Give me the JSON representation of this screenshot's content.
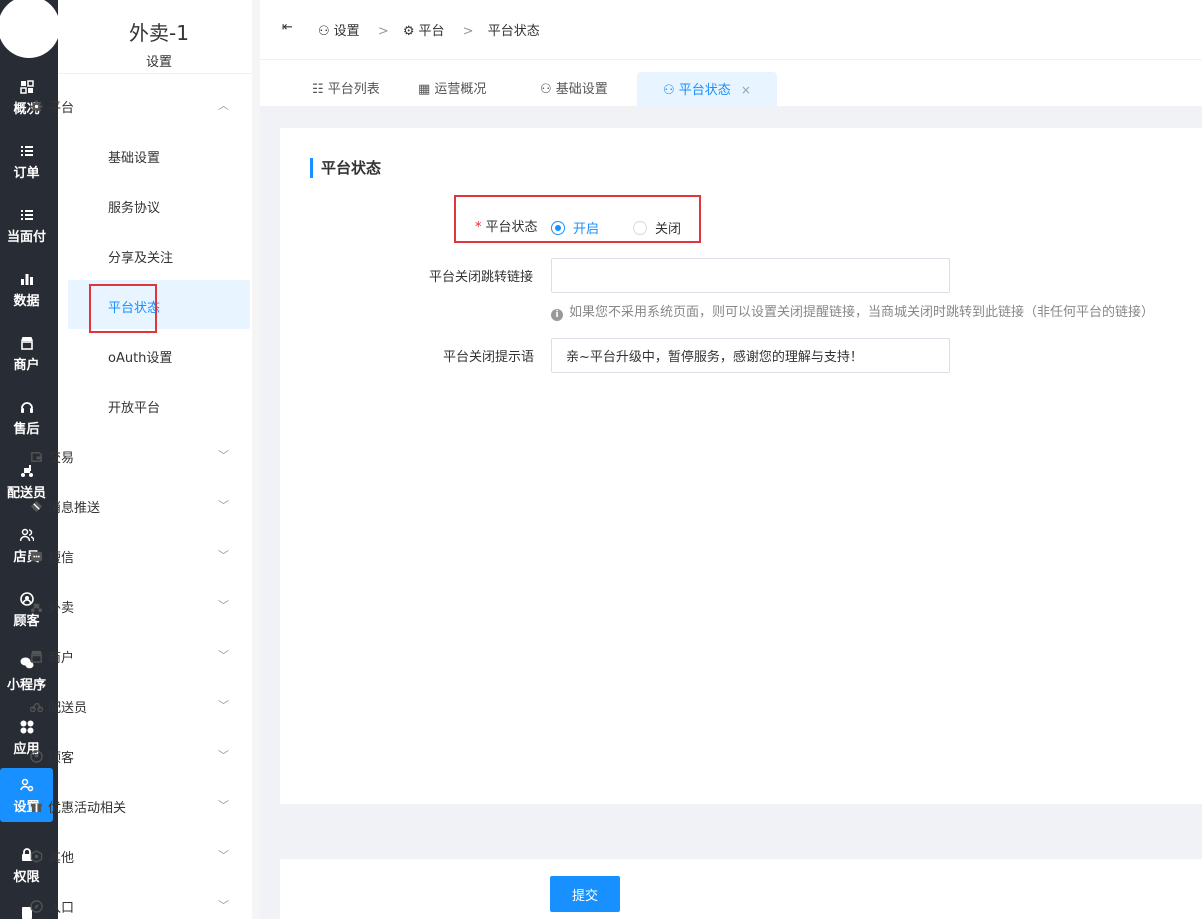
{
  "app": {
    "title": "外卖-1",
    "subtitle": "设置"
  },
  "rail": [
    {
      "label": "概况",
      "icon": "dashboard-icon"
    },
    {
      "label": "订单",
      "icon": "list-icon"
    },
    {
      "label": "当面付",
      "icon": "list-icon"
    },
    {
      "label": "数据",
      "icon": "bar-chart-icon"
    },
    {
      "label": "商户",
      "icon": "store-icon"
    },
    {
      "label": "售后",
      "icon": "headset-icon"
    },
    {
      "label": "配送员",
      "icon": "scooter-icon"
    },
    {
      "label": "店员",
      "icon": "users-icon"
    },
    {
      "label": "顾客",
      "icon": "user-circle-icon"
    },
    {
      "label": "小程序",
      "icon": "wechat-icon"
    },
    {
      "label": "应用",
      "icon": "apps-icon"
    },
    {
      "label": "设置",
      "icon": "settings-icon",
      "active": true
    },
    {
      "label": "权限",
      "icon": "lock-icon"
    }
  ],
  "sidebar": {
    "platform": {
      "label": "平台",
      "expanded": true
    },
    "sub_items": [
      "基础设置",
      "服务协议",
      "分享及关注",
      "平台状态",
      "oAuth设置",
      "开放平台"
    ],
    "active_sub": "平台状态",
    "groups": [
      "交易",
      "消息推送",
      "短信",
      "外卖",
      "商户",
      "配送员",
      "顾客",
      "优惠活动相关",
      "其他",
      "入口"
    ]
  },
  "breadcrumb": [
    "设置",
    "平台",
    "平台状态"
  ],
  "tabs": [
    "平台列表",
    "运营概况",
    "基础设置",
    "平台状态"
  ],
  "active_tab": "平台状态",
  "section": {
    "title": "平台状态"
  },
  "form": {
    "status_label": "平台状态",
    "status_options": [
      "开启",
      "关闭"
    ],
    "status_value": "开启",
    "redirect_label": "平台关闭跳转链接",
    "redirect_value": "",
    "redirect_hint": "如果您不采用系统页面，则可以设置关闭提醒链接，当商城关闭时跳转到此链接（非任何平台的链接）",
    "notice_label": "平台关闭提示语",
    "notice_value": "亲~平台升级中，暂停服务，感谢您的理解与支持！"
  },
  "submit_label": "提交",
  "colors": {
    "accent": "#1890ff",
    "rail_bg": "#282c34",
    "highlight": "#e0353a"
  }
}
